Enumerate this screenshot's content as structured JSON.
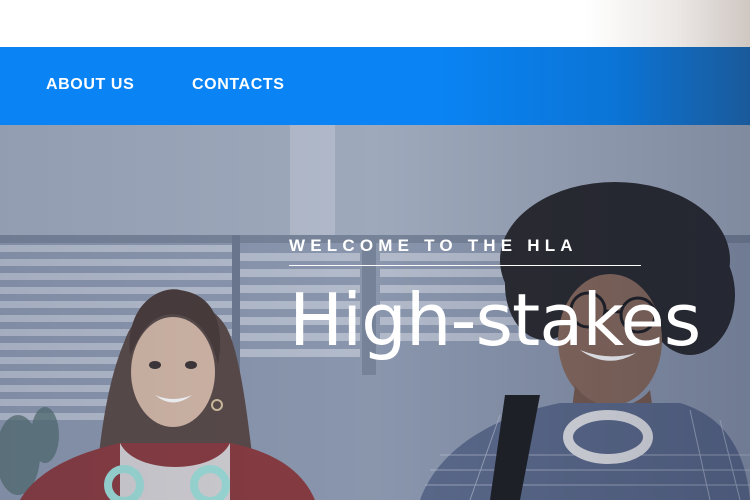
{
  "nav": {
    "items": [
      {
        "label": "ABOUT US"
      },
      {
        "label": "CONTACTS"
      }
    ]
  },
  "hero": {
    "eyebrow": "WELCOME TO THE HLA",
    "headline": "High-stakes"
  },
  "colors": {
    "nav_background": "#0a84f4",
    "nav_text": "#ffffff",
    "hero_text": "#ffffff"
  }
}
